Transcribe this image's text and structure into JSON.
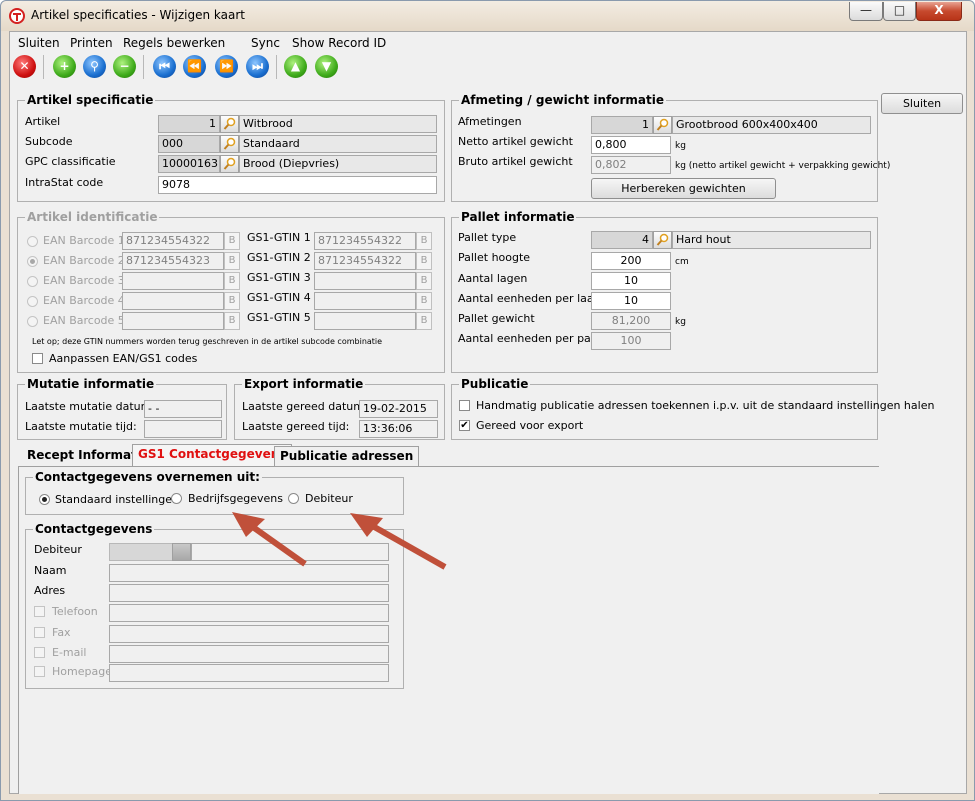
{
  "window": {
    "title": "Artikel specificaties - Wijzigen kaart",
    "close_glyph": "X",
    "minimize_glyph": "—",
    "maximize_glyph": "□"
  },
  "menu": {
    "items": [
      "Sluiten",
      "Printen",
      "Regels bewerken",
      "Sync",
      "Show Record ID"
    ]
  },
  "toolbar": {
    "icons": [
      "close-icon",
      "add-icon",
      "search-icon",
      "remove-icon",
      "first-record-icon",
      "previous-record-icon",
      "next-record-icon",
      "last-record-icon",
      "up-icon",
      "down-icon"
    ]
  },
  "sluiten_button": "Sluiten",
  "artikel_specificatie": {
    "title": "Artikel specificatie",
    "artikel_label": "Artikel",
    "artikel_value": "1",
    "artikel_desc": "Witbrood",
    "subcode_label": "Subcode",
    "subcode_value": "000",
    "subcode_desc": "Standaard",
    "gpc_label": "GPC classificatie",
    "gpc_value": "10000163",
    "gpc_desc": "Brood (Diepvries)",
    "intrastat_label": "IntraStat code",
    "intrastat_value": "9078"
  },
  "afmeting": {
    "title": "Afmeting / gewicht informatie",
    "afmetingen_label": "Afmetingen",
    "afmetingen_value": "1",
    "afmetingen_desc": "Grootbrood 600x400x400",
    "netto_label": "Netto artikel gewicht",
    "netto_value": "0,800",
    "netto_unit": "kg",
    "bruto_label": "Bruto artikel gewicht",
    "bruto_value": "0,802",
    "bruto_unit": "kg (netto artikel gewicht + verpakking gewicht)",
    "herbereken_button": "Herbereken gewichten"
  },
  "artikel_identificatie": {
    "title": "Artikel identificatie",
    "ean": [
      {
        "label": "EAN Barcode 1",
        "value": "871234554322",
        "selected": false
      },
      {
        "label": "EAN Barcode 2",
        "value": "871234554323",
        "selected": true
      },
      {
        "label": "EAN Barcode 3",
        "value": "",
        "selected": false
      },
      {
        "label": "EAN Barcode 4",
        "value": "",
        "selected": false
      },
      {
        "label": "EAN Barcode 5",
        "value": "",
        "selected": false
      }
    ],
    "gtin": [
      {
        "label": "GS1-GTIN 1",
        "value": "871234554322"
      },
      {
        "label": "GS1-GTIN 2",
        "value": "871234554322"
      },
      {
        "label": "GS1-GTIN 3",
        "value": ""
      },
      {
        "label": "GS1-GTIN 4",
        "value": ""
      },
      {
        "label": "GS1-GTIN 5",
        "value": ""
      }
    ],
    "b_label": "B",
    "note": "Let op; deze GTIN nummers worden terug geschreven in de artikel subcode combinatie",
    "aanpassen_label": "Aanpassen EAN/GS1 codes"
  },
  "pallet": {
    "title": "Pallet informatie",
    "type_label": "Pallet type",
    "type_value": "4",
    "type_desc": "Hard hout",
    "hoogte_label": "Pallet hoogte",
    "hoogte_value": "200",
    "hoogte_unit": "cm",
    "lagen_label": "Aantal lagen",
    "lagen_value": "10",
    "per_laag_label": "Aantal eenheden per laag",
    "per_laag_value": "10",
    "gewicht_label": "Pallet gewicht",
    "gewicht_value": "81,200",
    "gewicht_unit": "kg",
    "per_pallet_label": "Aantal eenheden per pallet",
    "per_pallet_value": "100"
  },
  "mutatie": {
    "title": "Mutatie informatie",
    "datum_label": "Laatste mutatie datum:",
    "datum_value": "- -",
    "tijd_label": "Laatste mutatie tijd:",
    "tijd_value": ""
  },
  "export": {
    "title": "Export informatie",
    "datum_label": "Laatste gereed datum:",
    "datum_value": "19-02-2015",
    "tijd_label": "Laatste gereed tijd:",
    "tijd_value": "13:36:06"
  },
  "publicatie": {
    "title": "Publicatie",
    "handmatig_label": "Handmatig publicatie adressen toekennen i.p.v. uit de standaard instellingen halen",
    "handmatig_checked": false,
    "gereed_label": "Gereed voor export",
    "gereed_checked": true,
    "check_glyph": "✔"
  },
  "tabs": {
    "items": [
      "Recept Informatie",
      "GS1 Contactgegevens",
      "Publicatie adressen"
    ],
    "active": 1
  },
  "contact_overnemen": {
    "title": "Contactgegevens overnemen uit:",
    "options": [
      "Standaard instellingen",
      "Bedrijfsgegevens",
      "Debiteur"
    ],
    "selected": 0
  },
  "contactgegevens": {
    "title": "Contactgegevens",
    "debiteur_label": "Debiteur",
    "naam_label": "Naam",
    "adres_label": "Adres",
    "telefoon_label": "Telefoon",
    "fax_label": "Fax",
    "email_label": "E-mail",
    "homepage_label": "Homepage"
  },
  "colors": {
    "active_tab": "#e01010",
    "annotation_arrow": "#c0503a"
  }
}
